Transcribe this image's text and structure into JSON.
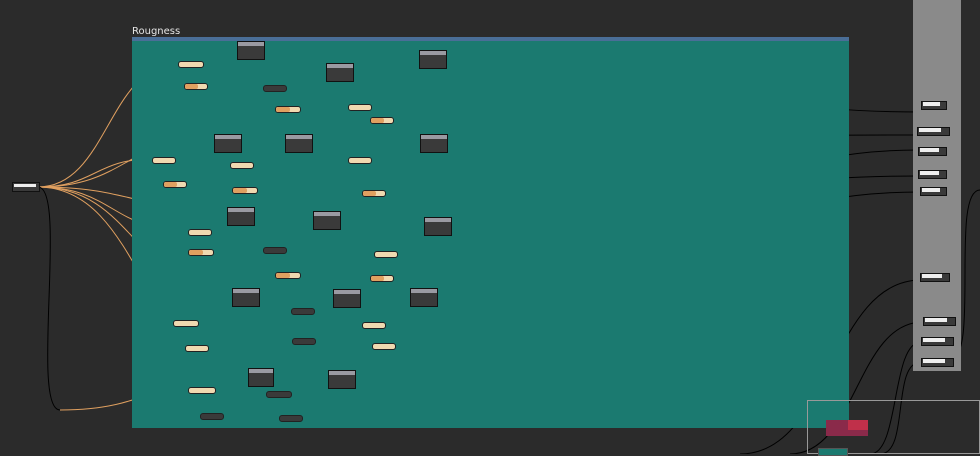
{
  "frame": {
    "title": "Rougness"
  },
  "colors": {
    "background": "#2b2b2b",
    "frame": "#1b7a70",
    "frame_header": "#4a6e97",
    "panel": "#8a8a8a",
    "wire_orange": "#e0a060",
    "wire_black": "#000000"
  },
  "icons": {
    "node_port": "port-icon"
  }
}
